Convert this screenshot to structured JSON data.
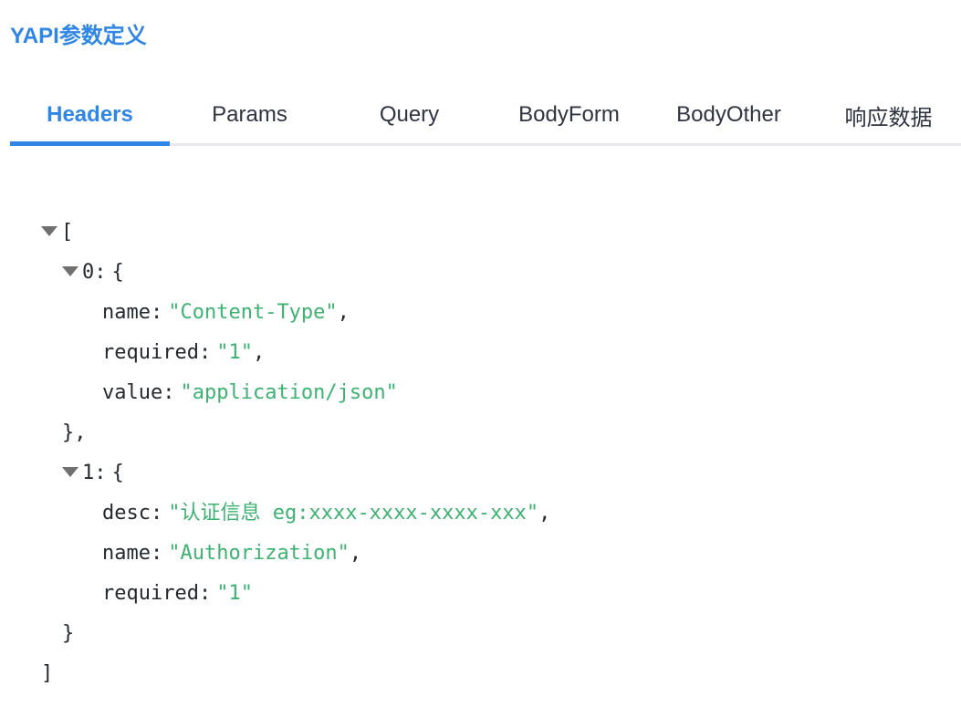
{
  "page": {
    "title": "YAPI参数定义"
  },
  "tabs": [
    {
      "label": "Headers",
      "active": true
    },
    {
      "label": "Params",
      "active": false
    },
    {
      "label": "Query",
      "active": false
    },
    {
      "label": "BodyForm",
      "active": false
    },
    {
      "label": "BodyOther",
      "active": false
    },
    {
      "label": "响应数据",
      "active": false
    }
  ],
  "json": {
    "open_bracket": "[",
    "close_bracket": "]",
    "items": [
      {
        "index": "0",
        "open": "{",
        "close": "},",
        "fields": [
          {
            "key": "name",
            "value": "\"Content-Type\"",
            "trail": ","
          },
          {
            "key": "required",
            "value": "\"1\"",
            "trail": ","
          },
          {
            "key": "value",
            "value": "\"application/json\"",
            "trail": ""
          }
        ]
      },
      {
        "index": "1",
        "open": "{",
        "close": "}",
        "fields": [
          {
            "key": "desc",
            "value": "\"认证信息 eg:xxxx-xxxx-xxxx-xxx\"",
            "trail": ","
          },
          {
            "key": "name",
            "value": "\"Authorization\"",
            "trail": ","
          },
          {
            "key": "required",
            "value": "\"1\"",
            "trail": ""
          }
        ]
      }
    ]
  },
  "colors": {
    "accent": "#2f86e6",
    "string": "#3cb371",
    "text": "#24292e",
    "tab_border": "#e8e9ef"
  },
  "icons": {
    "toggle": "caret-down-icon"
  }
}
